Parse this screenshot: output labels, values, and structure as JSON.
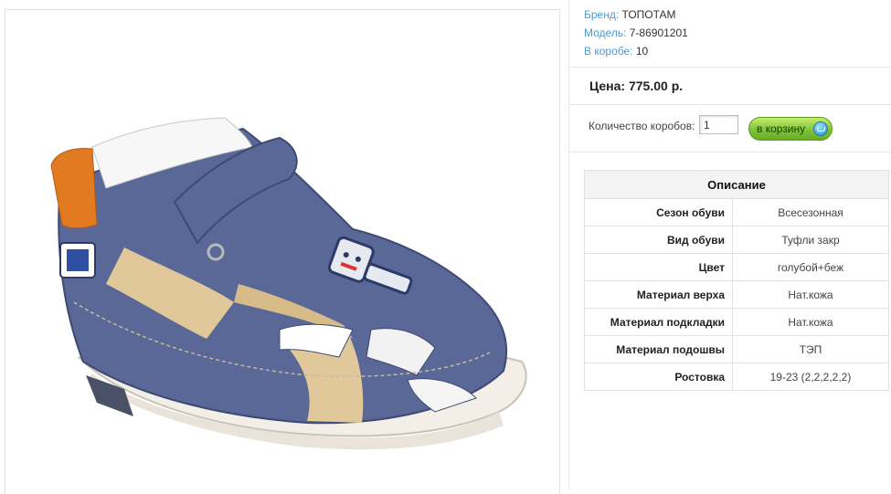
{
  "product": {
    "image_alt": "sandal",
    "brand": {
      "label": "Бренд:",
      "value": "ТОПОТАМ"
    },
    "model": {
      "label": "Модель:",
      "value": "7-86901201"
    },
    "per_box": {
      "label": "В коробе:",
      "value": "10"
    },
    "price": "Цена: 775.00 р."
  },
  "purchase": {
    "qty_label": "Количество коробов:",
    "qty_value": "1",
    "cart_button": "в корзину"
  },
  "specs": {
    "header": "Описание",
    "rows": [
      {
        "key": "Сезон обуви",
        "value": "Всесезонная"
      },
      {
        "key": "Вид обуви",
        "value": "Туфли закр"
      },
      {
        "key": "Цвет",
        "value": "голубой+беж"
      },
      {
        "key": "Материал верха",
        "value": "Нат.кожа"
      },
      {
        "key": "Материал подкладки",
        "value": "Нат.кожа"
      },
      {
        "key": "Материал подошвы",
        "value": "ТЭП"
      },
      {
        "key": "Ростовка",
        "value": "19-23 (2,2,2,2,2)"
      }
    ]
  },
  "colors": {
    "link": "#4a9bd6",
    "button_green": "#7fc33a",
    "leather_blue": "#5a6898",
    "leather_beige": "#e1c89a"
  }
}
